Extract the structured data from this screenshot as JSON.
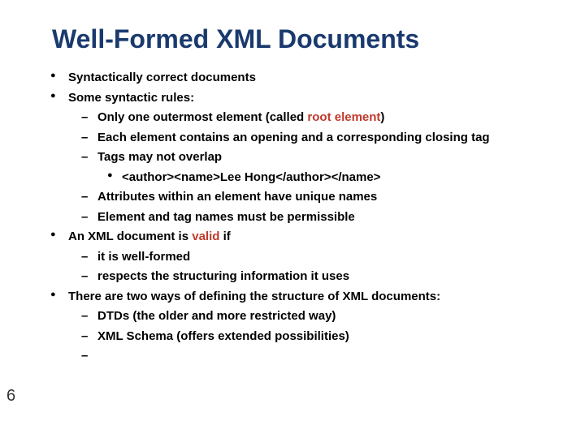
{
  "title": "Well-Formed XML Documents",
  "pageNumber": "6",
  "bullets": {
    "b1": "Syntactically correct documents",
    "b2": "Some syntactic rules:",
    "b2_1a": "Only one outermost element (called ",
    "b2_1b": "root element",
    "b2_1c": ")",
    "b2_2": "Each element contains an opening and a corresponding closing tag",
    "b2_3": "Tags may not overlap",
    "b2_3_1": "<author><name>Lee Hong</author></name>",
    "b2_4": "Attributes within an element have unique names",
    "b2_5": "Element and tag names must be permissible",
    "b3a": "An XML document is ",
    "b3b": "valid",
    "b3c": " if",
    "b3_1": "it is well-formed",
    "b3_2": "respects the structuring information it uses",
    "b4": "There are two ways of defining the structure of XML documents:",
    "b4_1": "DTDs (the older and more restricted way)",
    "b4_2": "XML Schema (offers extended possibilities)",
    "b4_3": ""
  }
}
